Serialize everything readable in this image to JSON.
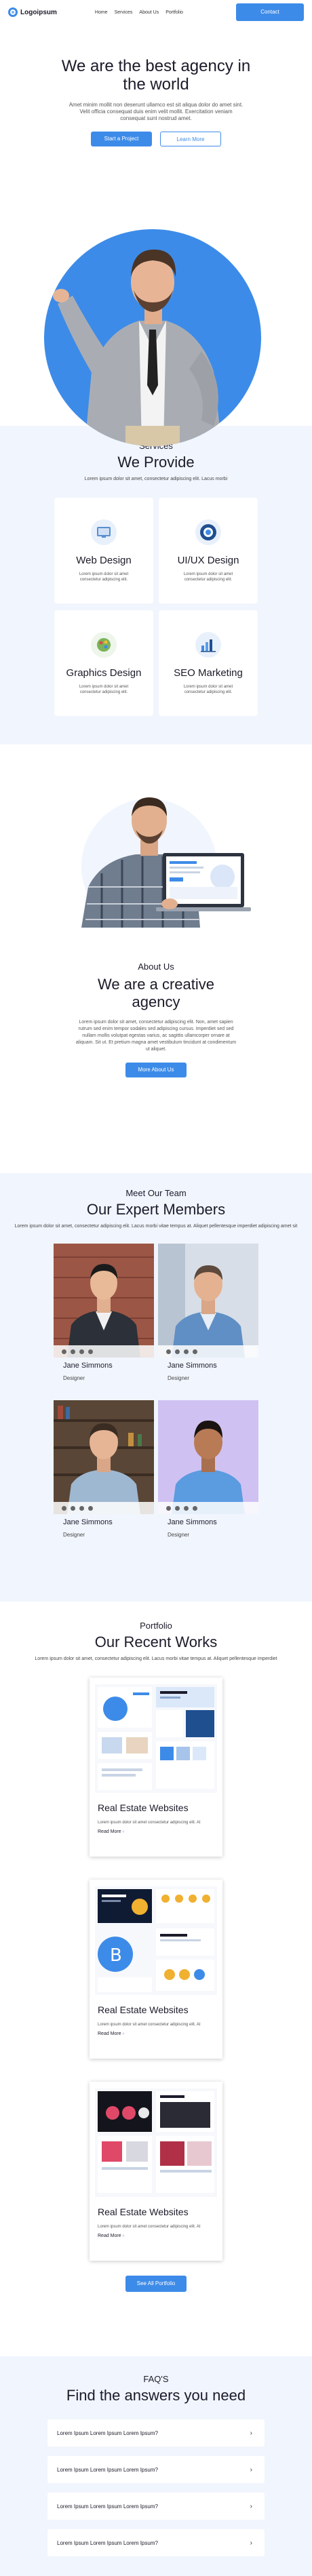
{
  "header": {
    "logo": "Logoipsum",
    "nav": [
      "Home",
      "Services",
      "About Us",
      "Portfolio"
    ],
    "contact": "Contact"
  },
  "hero": {
    "title": "We are the best agency in the world",
    "description": "Amet minim mollit non deserunt ullamco est sit aliqua dolor do amet sint. Velit officia consequat duis enim velit mollit. Exercitation veniam consequat sunt nostrud amet.",
    "primary_btn": "Start a Project",
    "secondary_btn": "Learn More"
  },
  "services": {
    "kicker": "Services",
    "title": "We Provide",
    "description": "Lorem ipsum dolor sit amet, consectetur adipiscing elit. Lacus morbi",
    "items": [
      {
        "name": "Web Design",
        "desc": "Lorem ipsum dolor sit amet consectetur adipiscing elit.",
        "icon": "web-design-icon"
      },
      {
        "name": "UI/UX Design",
        "desc": "Lorem ipsum dolor sit amet consectetur adipiscing elit.",
        "icon": "uiux-design-icon"
      },
      {
        "name": "Graphics Design",
        "desc": "Lorem ipsum dolor sit amet consectetur adipiscing elit.",
        "icon": "graphics-design-icon"
      },
      {
        "name": "SEO Marketing",
        "desc": "Lorem ipsum dolor sit amet consectetur adipiscing elit.",
        "icon": "seo-marketing-icon"
      }
    ]
  },
  "about": {
    "kicker": "About Us",
    "title": "We are a creative agency",
    "description": "Lorem ipsum dolor sit amet, consectetur adipiscing elit. Non, amet sapien rutrum sed enim tempor sodales sed adipiscing cursus. Imperdiet sed sed nullam mollis volutpat egestas varius, ac sagittis ullamcorper ornare at aliquam. Sit ut. Et pretium magna amet vestibulum tincidunt at condimentum ut aliquet.",
    "button": "More About Us"
  },
  "team": {
    "kicker": "Meet Our Team",
    "title": "Our Expert Members",
    "description": "Lorem ipsum dolor sit amet, consectetur adipiscing elit. Lacus morbi vitae tempus at. Aliquet pellentesque imperdiet adipiscing amet sit",
    "members": [
      {
        "name": "Jane Simmons",
        "role": "Designer"
      },
      {
        "name": "Jane Simmons",
        "role": "Designer"
      },
      {
        "name": "Jane Simmons",
        "role": "Designer"
      },
      {
        "name": "Jane Simmons",
        "role": "Designer"
      }
    ]
  },
  "portfolio": {
    "kicker": "Portfolio",
    "title": "Our Recent Works",
    "description": "Lorem ipsum dolor sit amet, consectetur adipiscing elit. Lacus morbi vitae tempus at. Aliquet pellentesque imperdiet",
    "works": [
      {
        "title": "Real Estate Websites",
        "desc": "Lorem ipsum dolor sit amet consectetur adipiscing elit. At",
        "link": "Read More"
      },
      {
        "title": "Real Estate Websites",
        "desc": "Lorem ipsum dolor sit amet consectetur adipiscing elit. At",
        "link": "Read More"
      },
      {
        "title": "Real Estate Websites",
        "desc": "Lorem ipsum dolor sit amet consectetur adipiscing elit. At",
        "link": "Read More"
      }
    ],
    "button": "See All Portfolio"
  },
  "faq": {
    "kicker": "FAQ'S",
    "title": "Find the answers you need",
    "items": [
      "Lorem Ipsum Lorem Ipsum Lorem Ipsum?",
      "Lorem Ipsum Lorem Ipsum Lorem Ipsum?",
      "Lorem Ipsum Lorem Ipsum Lorem Ipsum?",
      "Lorem Ipsum Lorem Ipsum Lorem Ipsum?"
    ]
  },
  "colors": {
    "accent": "#3d8be8",
    "section_bg": "#f1f5fd"
  }
}
